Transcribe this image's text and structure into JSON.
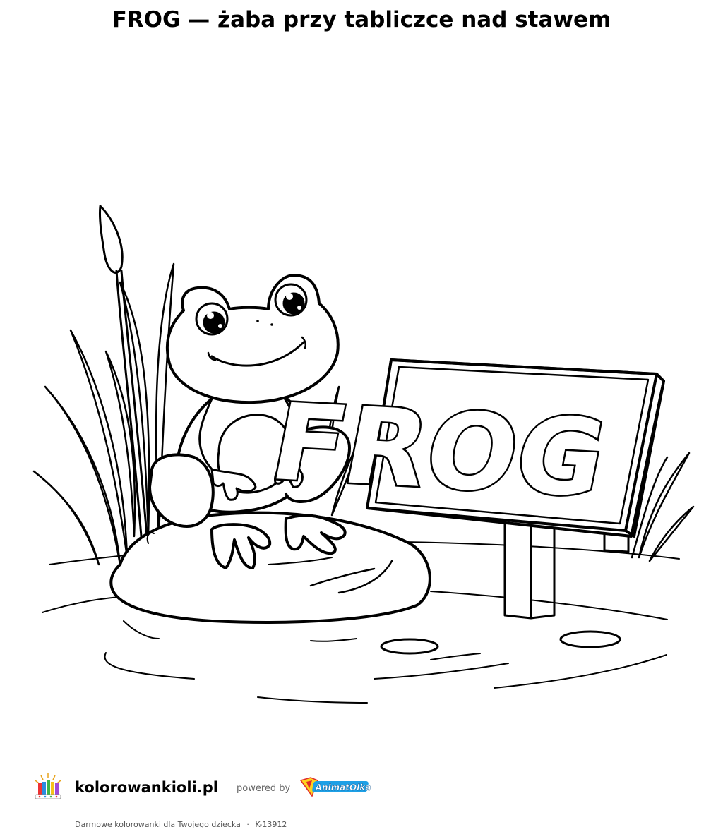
{
  "page": {
    "title": "FROG — żaba przy tabliczce nad stawem"
  },
  "illustration": {
    "sign_text": "FROG",
    "subjects": [
      "frog",
      "sign",
      "rock",
      "pond",
      "cattails",
      "reeds",
      "lily-pads"
    ]
  },
  "footer": {
    "site": "kolorowankioli.pl",
    "powered_by": "powered by",
    "partner": "AnimatOlka",
    "tagline": "Darmowe kolorowanki dla Twojego dziecka",
    "separator": "·",
    "code": "K-13912"
  },
  "colors": {
    "ink": "#000000",
    "paper": "#ffffff",
    "partner_blue": "#1ea0e6",
    "partner_red": "#e02a2a",
    "partner_yellow": "#ffd21f"
  }
}
